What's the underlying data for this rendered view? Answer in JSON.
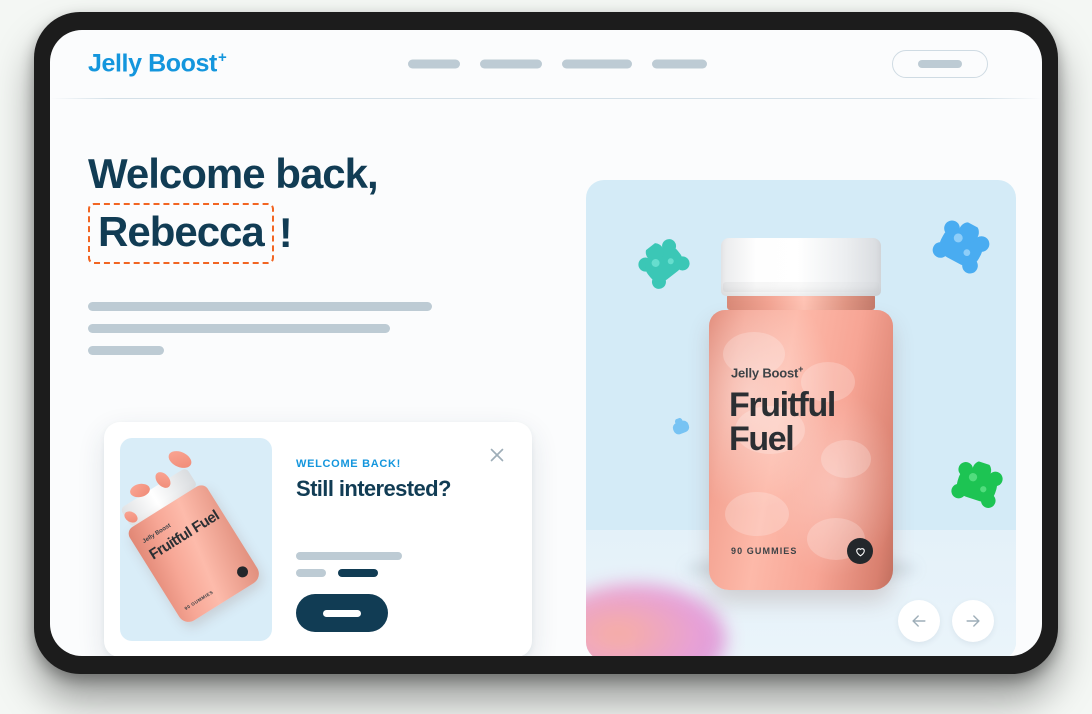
{
  "brand": {
    "name": "Jelly Boost",
    "plus": "+"
  },
  "header": {
    "nav_items": [
      "",
      "",
      "",
      ""
    ],
    "cta_label": ""
  },
  "hero": {
    "greeting_line1": "Welcome back,",
    "user_name": "Rebecca",
    "exclamation": "!",
    "body_lines": [
      "",
      "",
      ""
    ]
  },
  "promo_card": {
    "eyebrow": "WELCOME BACK!",
    "title": "Still interested?",
    "close_icon": "close-icon",
    "button_label": "",
    "thumbnail": {
      "brand": "Jelly Boost",
      "plus": "+",
      "product_name": "Fruitful Fuel",
      "count": "90 GUMMIES"
    }
  },
  "product_panel": {
    "brand": "Jelly Boost",
    "plus": "+",
    "product_name_line1": "Fruitful",
    "product_name_line2": "Fuel",
    "count": "90 GUMMIES",
    "badge_icon": "heart-icon",
    "carousel": {
      "prev_icon": "arrow-left-icon",
      "next_icon": "arrow-right-icon"
    },
    "decorations": [
      {
        "name": "gummy-bear-teal",
        "color": "#2ec4b0"
      },
      {
        "name": "gummy-bear-blue",
        "color": "#3aa6f0"
      },
      {
        "name": "gummy-bear-green",
        "color": "#14c24a"
      },
      {
        "name": "gummy-bear-mini-blue",
        "color": "#5bb8f2"
      }
    ]
  },
  "colors": {
    "brand_blue": "#1496dd",
    "headline_navy": "#113c54",
    "highlight_orange": "#f26522",
    "skeleton_grey": "#bdcbd4",
    "panel_blue": "#d4ebf7",
    "page_bg": "#fbfcfd",
    "bezel": "#1c1c1c"
  }
}
